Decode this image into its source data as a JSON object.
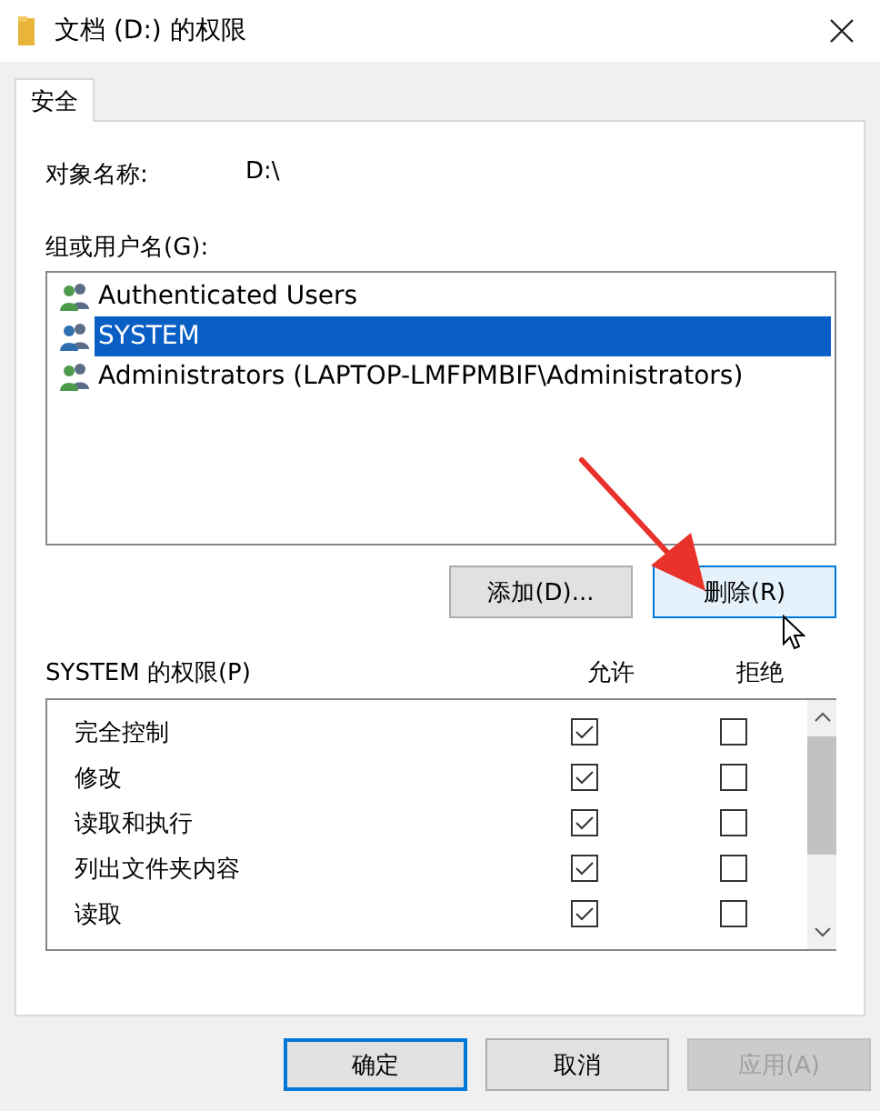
{
  "window": {
    "title": "文档 (D:) 的权限"
  },
  "tabs": [
    {
      "label": "安全",
      "selected": true
    }
  ],
  "object_name": {
    "label": "对象名称:",
    "value": "D:\\"
  },
  "groups": {
    "label": "组或用户名(G):",
    "items": [
      {
        "name": "Authenticated Users",
        "selected": false
      },
      {
        "name": "SYSTEM",
        "selected": true
      },
      {
        "name": "Administrators (LAPTOP-LMFPMBIF\\Administrators)",
        "selected": false
      }
    ]
  },
  "group_buttons": [
    {
      "label": "添加(D)...",
      "hovered": false
    },
    {
      "label": "删除(R)",
      "hovered": true
    }
  ],
  "permissions": {
    "label": "SYSTEM 的权限(P)",
    "columns": [
      "允许",
      "拒绝"
    ],
    "rows": [
      {
        "name": "完全控制",
        "allow": true,
        "deny": false
      },
      {
        "name": "修改",
        "allow": true,
        "deny": false
      },
      {
        "name": "读取和执行",
        "allow": true,
        "deny": false
      },
      {
        "name": "列出文件夹内容",
        "allow": true,
        "deny": false
      },
      {
        "name": "读取",
        "allow": true,
        "deny": false
      }
    ]
  },
  "buttons": [
    {
      "label": "确定",
      "default": true,
      "disabled": false
    },
    {
      "label": "取消",
      "default": false,
      "disabled": false
    },
    {
      "label": "应用(A)",
      "default": false,
      "disabled": true
    }
  ]
}
